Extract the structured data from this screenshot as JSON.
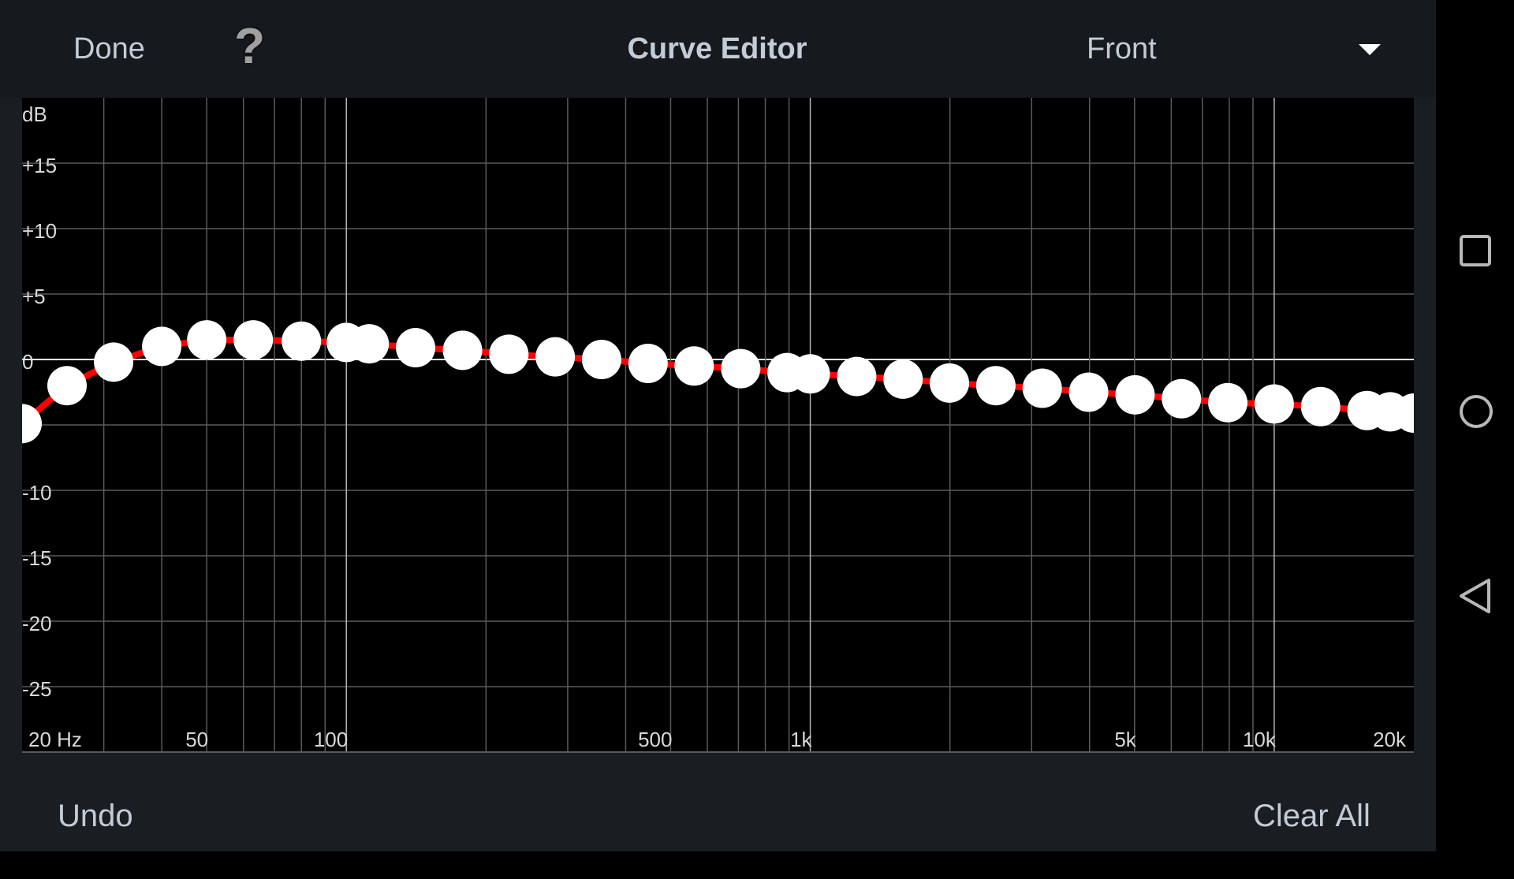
{
  "header": {
    "done_label": "Done",
    "help_label": "?",
    "title": "Curve Editor",
    "channel_selected": "Front"
  },
  "footer": {
    "undo_label": "Undo",
    "clear_all_label": "Clear All"
  },
  "navbar": {
    "icons": [
      "recents-square-icon",
      "home-circle-icon",
      "back-triangle-icon"
    ]
  },
  "colors": {
    "curve": "#ff0000",
    "handle": "#ffffff",
    "grid": "#5a5a5a",
    "grid_major": "#b4b4b4",
    "text": "#c3ccd6"
  },
  "chart_data": {
    "type": "line",
    "title": "Curve Editor",
    "xlabel": "",
    "ylabel": "dB",
    "xscale": "log",
    "xlim": [
      20,
      20000
    ],
    "ylim": [
      -30,
      20
    ],
    "grid": true,
    "y_ticks": [
      {
        "value": 15,
        "label": "+15"
      },
      {
        "value": 10,
        "label": "+10"
      },
      {
        "value": 5,
        "label": "+5"
      },
      {
        "value": 0,
        "label": "0"
      },
      {
        "value": -5,
        "label": ""
      },
      {
        "value": -10,
        "label": "-10"
      },
      {
        "value": -15,
        "label": "-15"
      },
      {
        "value": -20,
        "label": "-20"
      },
      {
        "value": -25,
        "label": "-25"
      }
    ],
    "y_unit_label": "dB",
    "x_ticks": [
      {
        "value": 20,
        "label": "20 Hz"
      },
      {
        "value": 50,
        "label": "50"
      },
      {
        "value": 100,
        "label": "100"
      },
      {
        "value": 500,
        "label": "500"
      },
      {
        "value": 1000,
        "label": "1k"
      },
      {
        "value": 5000,
        "label": "5k"
      },
      {
        "value": 10000,
        "label": "10k"
      },
      {
        "value": 20000,
        "label": "20k"
      }
    ],
    "x_gridlines": [
      30,
      40,
      50,
      60,
      70,
      80,
      90,
      100,
      200,
      300,
      400,
      500,
      600,
      700,
      800,
      900,
      1000,
      2000,
      3000,
      4000,
      5000,
      6000,
      7000,
      8000,
      9000,
      10000
    ],
    "x_major_gridlines": [
      100,
      1000,
      10000
    ],
    "series": [
      {
        "name": "Front",
        "x": [
          20,
          25,
          31.5,
          40,
          50,
          63,
          80,
          100,
          112,
          141,
          178,
          224,
          282,
          355,
          447,
          562,
          708,
          891,
          1000,
          1259,
          1585,
          1995,
          2512,
          3162,
          3981,
          5012,
          6310,
          7943,
          10000,
          12589,
          15849,
          17783,
          20000
        ],
        "y": [
          -4.9,
          -2.0,
          -0.2,
          1.0,
          1.5,
          1.5,
          1.4,
          1.3,
          1.2,
          0.9,
          0.7,
          0.4,
          0.2,
          0.0,
          -0.3,
          -0.5,
          -0.7,
          -1.0,
          -1.1,
          -1.3,
          -1.5,
          -1.8,
          -2.0,
          -2.2,
          -2.5,
          -2.7,
          -3.0,
          -3.3,
          -3.4,
          -3.6,
          -3.9,
          -4.0,
          -4.1
        ]
      }
    ]
  }
}
